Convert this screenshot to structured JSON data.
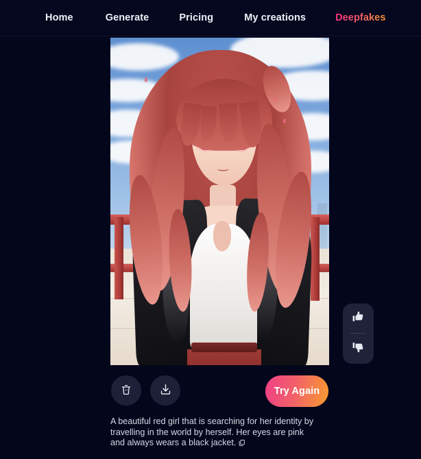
{
  "app": {
    "background_color": "#04061c",
    "accent_gradient_start": "#f5347f",
    "accent_gradient_end": "#f79432"
  },
  "navbar": {
    "items": [
      {
        "label": "Home",
        "active": false
      },
      {
        "label": "Generate",
        "active": false
      },
      {
        "label": "Pricing",
        "active": false
      },
      {
        "label": "My creations",
        "active": false
      },
      {
        "label": "Deepfakes",
        "active": true
      }
    ]
  },
  "result": {
    "image_alt": "Anime illustration of a red-haired girl with pink eyes wearing a black jacket over a white top, standing by a red railing with a blue cloudy sky and city skyline behind her",
    "feedback": {
      "thumbs_up_icon": "thumbs-up-icon",
      "thumbs_down_icon": "thumbs-down-icon"
    },
    "actions": {
      "delete_icon": "trash-icon",
      "download_icon": "download-icon",
      "try_again_label": "Try Again"
    },
    "prompt_text": "A beautiful red girl that is searching for her identity by travelling in the world by herself. Her eyes are pink and always wears a black jacket.",
    "copy_icon": "copy-icon"
  }
}
